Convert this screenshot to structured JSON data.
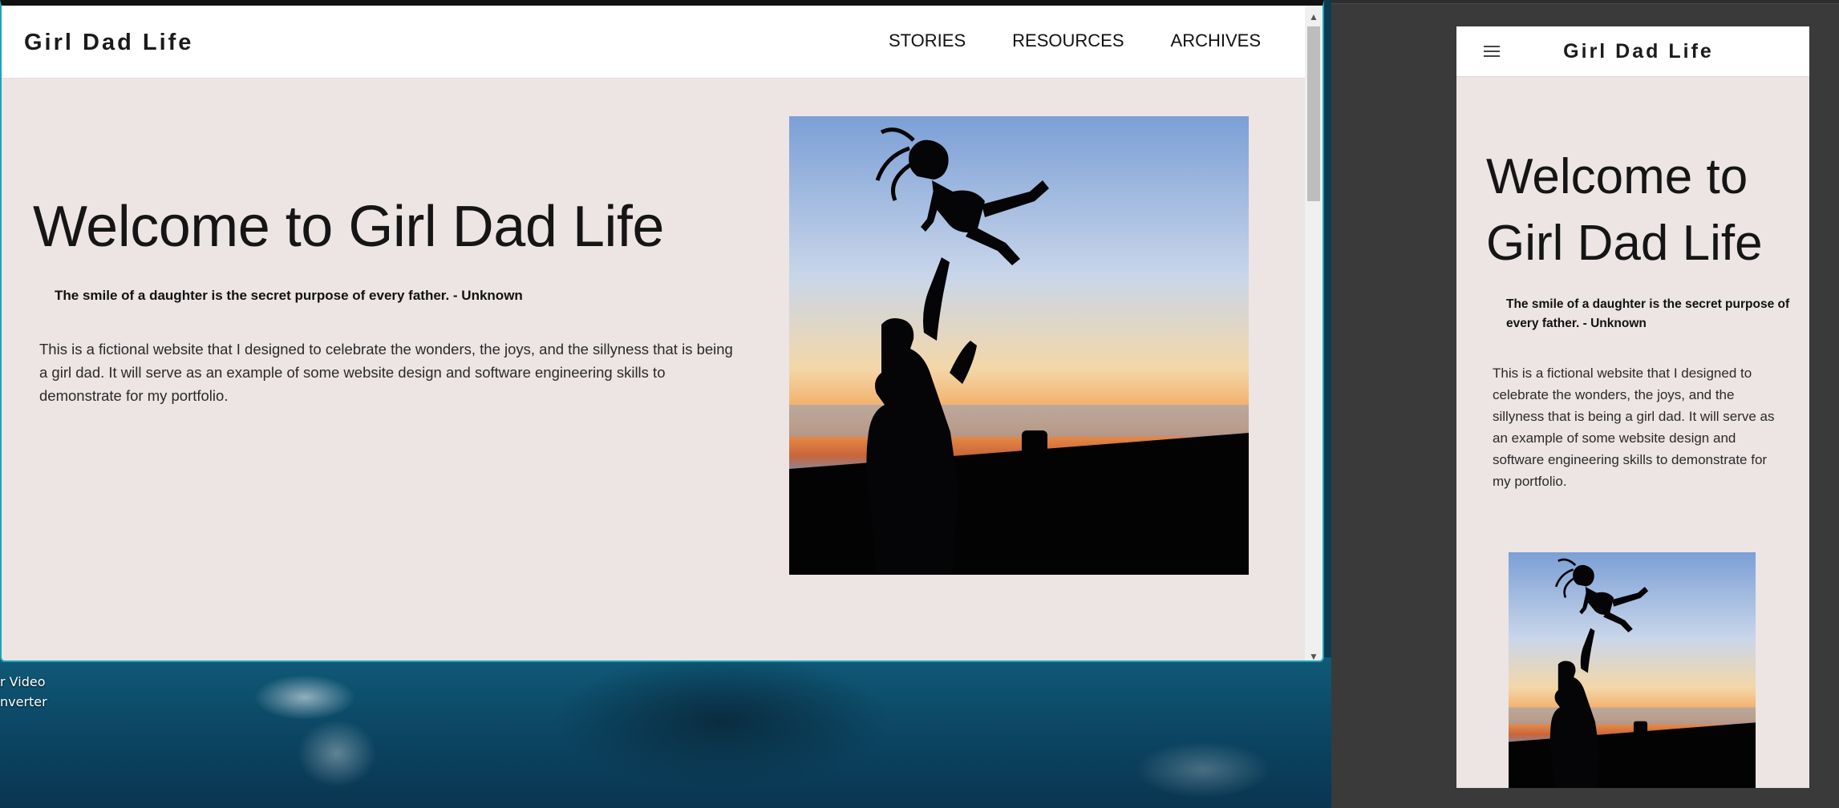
{
  "site": {
    "brand": "Girl Dad Life",
    "nav": [
      "STORIES",
      "RESOURCES",
      "ARCHIVES"
    ]
  },
  "hero": {
    "title": "Welcome to Girl Dad Life",
    "quote": "The smile of a daughter is the secret purpose of every father. - Unknown",
    "intro": "This is a fictional website that I designed to celebrate the wonders, the joys, and the sillyness that is being a girl dad. It will serve as an example of some website design and software engineering skills to demonstrate for my portfolio."
  },
  "mobile": {
    "title_line1": "Welcome to",
    "title_line2": "Girl Dad Life"
  },
  "desktop": {
    "icon_label_line1": "r Video",
    "icon_label_line2": "nverter"
  },
  "colors": {
    "page_bg": "#ede4e4",
    "window_border": "#1aa6b8",
    "dark_panel": "#3a3a3a"
  }
}
